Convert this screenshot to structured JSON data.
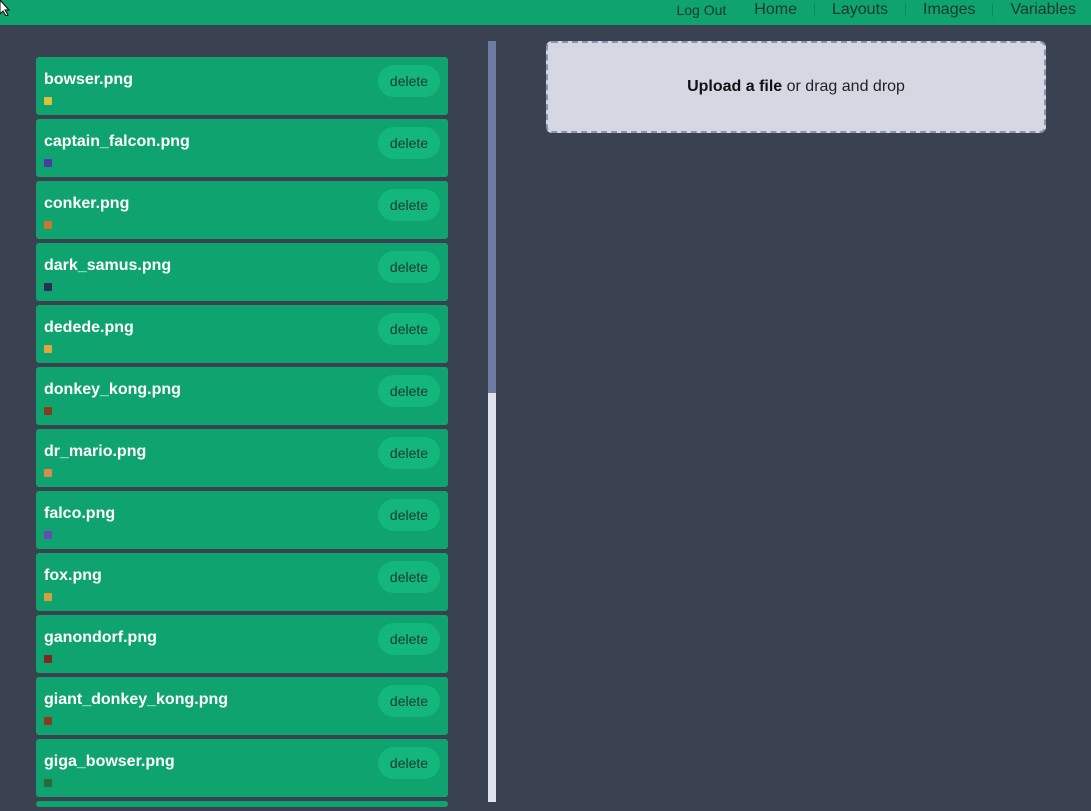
{
  "nav": {
    "logout": "Log Out",
    "links": [
      "Home",
      "Layouts",
      "Images",
      "Variables"
    ]
  },
  "images": [
    {
      "name": "bowser.png",
      "thumb_color": "#d9c43a"
    },
    {
      "name": "captain_falcon.png",
      "thumb_color": "#4b3aa8"
    },
    {
      "name": "conker.png",
      "thumb_color": "#c9772a"
    },
    {
      "name": "dark_samus.png",
      "thumb_color": "#2a2f55"
    },
    {
      "name": "dedede.png",
      "thumb_color": "#e0a63a"
    },
    {
      "name": "donkey_kong.png",
      "thumb_color": "#8a3a1c"
    },
    {
      "name": "dr_mario.png",
      "thumb_color": "#d88a4a"
    },
    {
      "name": "falco.png",
      "thumb_color": "#6a4ab8"
    },
    {
      "name": "fox.png",
      "thumb_color": "#d8a03a"
    },
    {
      "name": "ganondorf.png",
      "thumb_color": "#7a2a1a"
    },
    {
      "name": "giant_donkey_kong.png",
      "thumb_color": "#8a3a1c"
    },
    {
      "name": "giga_bowser.png",
      "thumb_color": "#2a6a3a"
    }
  ],
  "delete_label": "delete",
  "upload": {
    "link": "Upload a file",
    "rest": " or drag and drop"
  },
  "colors": {
    "accent": "#0fa46f",
    "background": "#3a4150",
    "upload_bg": "#d5d8e3",
    "scroll_thumb": "#6f7aa2"
  }
}
